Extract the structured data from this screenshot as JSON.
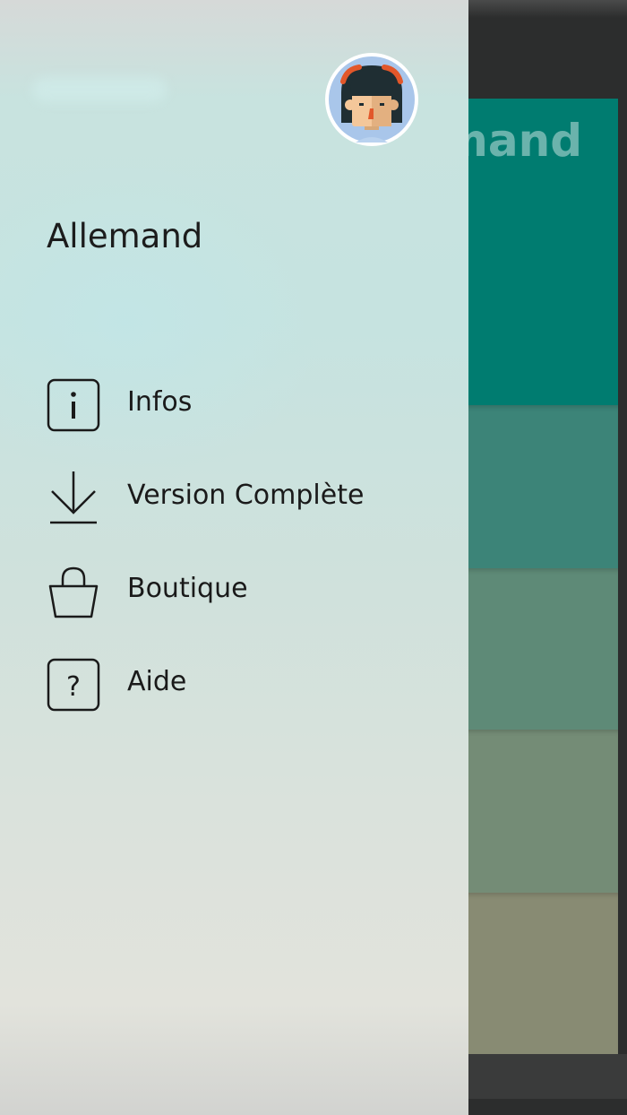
{
  "background": {
    "header_title": "Allemand",
    "colors": {
      "header": "#007c70",
      "band_1": "#3c8478",
      "band_2": "#5e8a77",
      "band_3": "#748c76",
      "band_4": "#888b73",
      "dark": "#2c2d2d"
    }
  },
  "drawer": {
    "app_name": "Allemand",
    "avatar": {
      "icon": "avatar-girl-icon"
    },
    "menu": [
      {
        "label": "Infos",
        "icon": "info-icon"
      },
      {
        "label": "Version Complète",
        "icon": "download-icon"
      },
      {
        "label": "Boutique",
        "icon": "shopping-bag-icon"
      },
      {
        "label": "Aide",
        "icon": "help-icon"
      }
    ]
  }
}
